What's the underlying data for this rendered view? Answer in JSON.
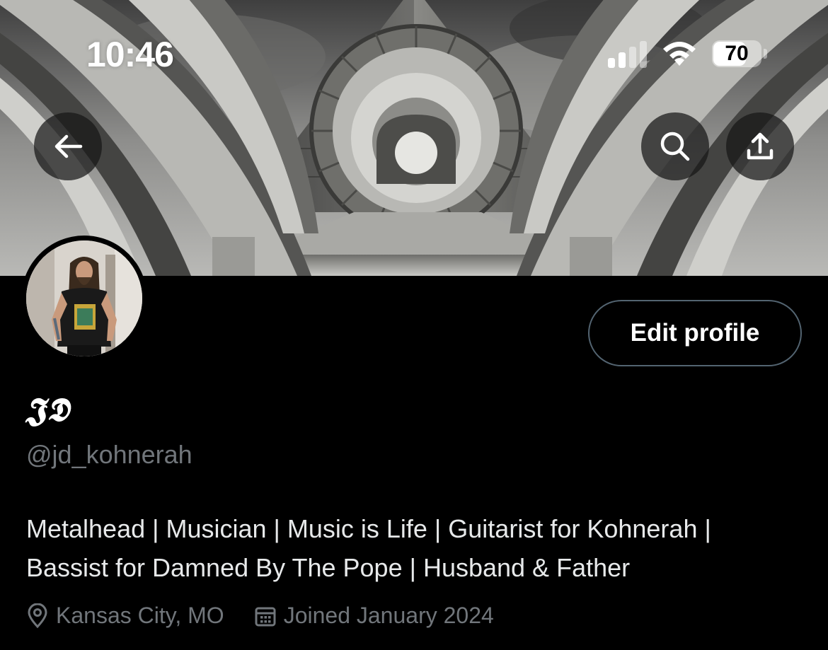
{
  "status_bar": {
    "time": "10:46",
    "battery_level": "70",
    "battery_fraction": 0.7,
    "signal_bars_active": 2,
    "signal_bars_total": 4
  },
  "header": {
    "back_icon": "arrow-left-icon",
    "search_icon": "search-icon",
    "share_icon": "share-upload-icon"
  },
  "profile": {
    "display_name": "𝕵𝕯",
    "handle": "@jd_kohnerah",
    "bio_line1": "Metalhead | Musician | Music is Life | Guitarist for Kohnerah |",
    "bio_line2": "Bassist for Damned By The Pope | Husband & Father",
    "location": "Kansas City, MO",
    "joined": "Joined January 2024",
    "edit_profile_label": "Edit profile"
  },
  "colors": {
    "background": "#000000",
    "primary_text": "#e7e9ea",
    "secondary_text": "#71767b",
    "button_border": "#536471"
  }
}
